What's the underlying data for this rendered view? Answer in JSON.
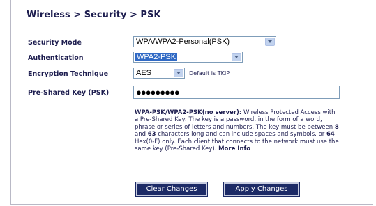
{
  "breadcrumb": {
    "wireless": "Wireless",
    "security": "Security",
    "psk": "PSK",
    "separator": ">"
  },
  "form": {
    "security_mode": {
      "label": "Security Mode",
      "value": "WPA/WPA2-Personal(PSK)"
    },
    "authentication": {
      "label": "Authentication",
      "value": "WPA2-PSK"
    },
    "encryption": {
      "label": "Encryption Technique",
      "value": "AES",
      "note": "Default is TKIP"
    },
    "psk": {
      "label": "Pre-Shared Key (PSK)",
      "value": "●●●●●●●●●"
    }
  },
  "help": {
    "title": "WPA-PSK/WPA2-PSK(no server):",
    "text1": " Wireless Protected Access with a Pre-Shared Key: The key is a password, in the form of a word, phrase or series of letters and numbers. The key must be between ",
    "min": "8",
    "text2": " and ",
    "max": "63",
    "text3": " characters long and can include spaces and symbols, or ",
    "hex": "64",
    "text4": " Hex(0-F) only. Each client that connects to the network must use the same key (Pre-Shared Key). ",
    "more_info": "More Info"
  },
  "buttons": {
    "clear": "Clear Changes",
    "apply": "Apply Changes"
  },
  "colors": {
    "label_text": "#1d1d4f",
    "button_bg": "#1c2a66",
    "selection": "#316ac5"
  }
}
